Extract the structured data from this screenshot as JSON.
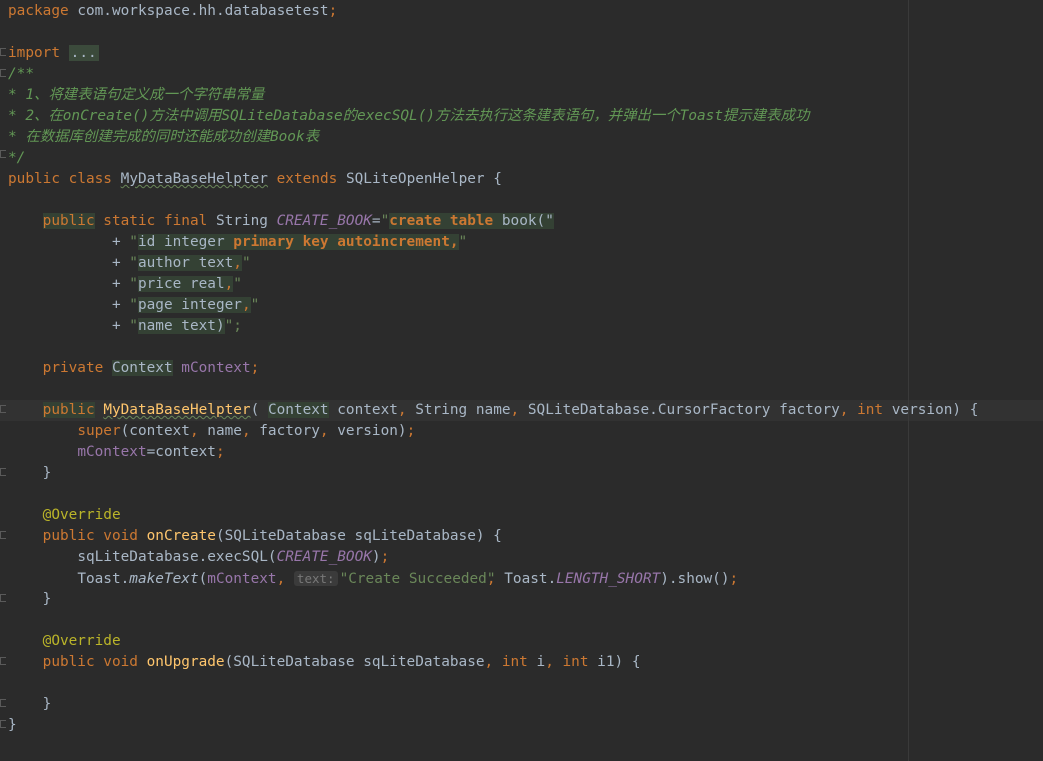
{
  "code": {
    "package_kw": "package",
    "package_name": " com.workspace.hh.databasetest",
    "semicolon": ";",
    "import_kw": "import",
    "import_fold": "...",
    "comment": [
      "/**",
      "* 1、将建表语句定义成一个字符串常量",
      "* 2、在onCreate()方法中调用SQLiteDatabase的execSQL()方法去执行这条建表语句，并弹出一个Toast提示建表成功",
      "* 在数据库创建完成的同时还能成功创建Book表",
      "*/"
    ],
    "class_decl": {
      "public": "public",
      "class": "class",
      "name": "MyDataBaseHelpter",
      "extends": "extends",
      "parent": "SQLiteOpenHelper",
      "brace": " {"
    },
    "const_decl": {
      "public": "public",
      "static_final": " static final ",
      "type": "String ",
      "name": "CREATE_BOOK",
      "eq": "=",
      "q": "\"",
      "create_table": "create table",
      "rest": " book(\""
    },
    "sql_lines": [
      {
        "plus": "+ ",
        "q": "\"",
        "a": "id integer ",
        "b": "primary key autoincrement,",
        "end": "\""
      },
      {
        "plus": "+ ",
        "q": "\"",
        "a": "author text",
        "b": ",",
        "end": "\""
      },
      {
        "plus": "+ ",
        "q": "\"",
        "a": "price real",
        "b": ",",
        "end": "\""
      },
      {
        "plus": "+ ",
        "q": "\"",
        "a": "page integer",
        "b": ",",
        "end": "\""
      },
      {
        "plus": "+ ",
        "q": "\"",
        "a": "name text)",
        "b": "",
        "end": "\";"
      }
    ],
    "field_decl": {
      "private": "private ",
      "type": "Context",
      "name": "mContext",
      "semi": ";"
    },
    "ctor": {
      "public": "public",
      "name": "MyDataBaseHelpter",
      "open": "( ",
      "t1": "Context",
      "p1": " context",
      "comma": ", ",
      "t2": "String name",
      "t3": "SQLiteDatabase.CursorFactory factory",
      "t4kw": "int",
      "p4": " version) {",
      "super_kw": "super",
      "super_args1": "(context",
      "super_args2": "name",
      "super_args3": "factory",
      "super_args4": "version)",
      "assign_field": "mContext",
      "assign_rest": "=context",
      "close": "}"
    },
    "override": "@Override",
    "oncreate": {
      "public": "public void ",
      "name": "onCreate",
      "params": "(SQLiteDatabase sqLiteDatabase) {",
      "exec_obj": "sqLiteDatabase.execSQL(",
      "exec_arg": "CREATE_BOOK",
      "exec_end": ")",
      "toast_obj": "Toast.",
      "toast_fn": "makeText",
      "toast_open": "(",
      "toast_field": "mContext",
      "hint": "text:",
      "toast_str": "\"Create Succeeded\"",
      "toast_mid": "Toast.",
      "toast_const": "LENGTH_SHORT",
      "toast_end": ").show()",
      "close": "}"
    },
    "onupgrade": {
      "public": "public void ",
      "name": "onUpgrade",
      "params_a": "(SQLiteDatabase sqLiteDatabase",
      "int": "int",
      "i": " i",
      "i1": " i1) {",
      "close": "}"
    },
    "class_close": "}"
  }
}
